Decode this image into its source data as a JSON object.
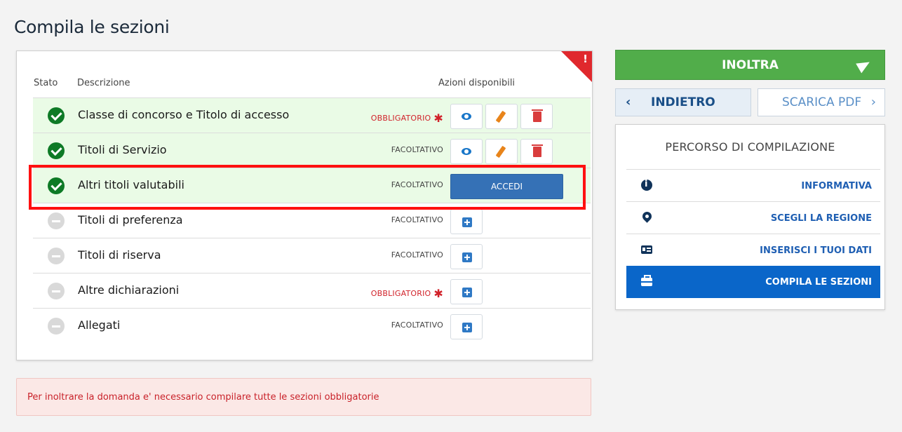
{
  "page": {
    "title": "Compila le sezioni"
  },
  "flag": {
    "mark": "!"
  },
  "table": {
    "headers": {
      "stato": "Stato",
      "descrizione": "Descrizione",
      "azioni": "Azioni disponibili"
    },
    "rows": [
      {
        "label": "Classe di concorso e Titolo di accesso",
        "requirement": "OBBLIGATORIO",
        "mandatory": true,
        "done": true,
        "actions": "view-edit-delete"
      },
      {
        "label": "Titoli di Servizio",
        "requirement": "FACOLTATIVO",
        "mandatory": false,
        "done": true,
        "actions": "view-edit-delete"
      },
      {
        "label": "Altri titoli valutabili",
        "requirement": "FACOLTATIVO",
        "mandatory": false,
        "done": true,
        "actions": "accedi",
        "action_label": "ACCEDI"
      },
      {
        "label": "Titoli di preferenza",
        "requirement": "FACOLTATIVO",
        "mandatory": false,
        "done": false,
        "actions": "add"
      },
      {
        "label": "Titoli di riserva",
        "requirement": "FACOLTATIVO",
        "mandatory": false,
        "done": false,
        "actions": "add"
      },
      {
        "label": "Altre dichiarazioni",
        "requirement": "OBBLIGATORIO",
        "mandatory": true,
        "done": false,
        "actions": "add"
      },
      {
        "label": "Allegati",
        "requirement": "FACOLTATIVO",
        "mandatory": false,
        "done": false,
        "actions": "add"
      }
    ],
    "star": "✱"
  },
  "alert": {
    "text": "Per inoltrare la domanda e' necessario compilare tutte le sezioni obbligatorie"
  },
  "side": {
    "inoltra_label": "INOLTRA",
    "back_label": "INDIETRO",
    "back_chevron": "‹",
    "pdf_label": "SCARICA PDF",
    "pdf_chevron": "›",
    "path_title": "PERCORSO DI COMPILAZIONE",
    "path_items": [
      {
        "label": "INFORMATIVA",
        "icon": "info-icon"
      },
      {
        "label": "SCEGLI LA REGIONE",
        "icon": "map-pin-icon"
      },
      {
        "label": "INSERISCI I TUOI DATI",
        "icon": "id-card-icon"
      },
      {
        "label": "COMPILA LE SEZIONI",
        "icon": "briefcase-icon",
        "active": true
      }
    ]
  },
  "colors": {
    "accent_green": "#51ad4a",
    "done_row_bg": "#eafbe6",
    "mandatory_red": "#d1222a",
    "active_blue": "#0a66c9",
    "highlight_red": "#ff1010"
  }
}
